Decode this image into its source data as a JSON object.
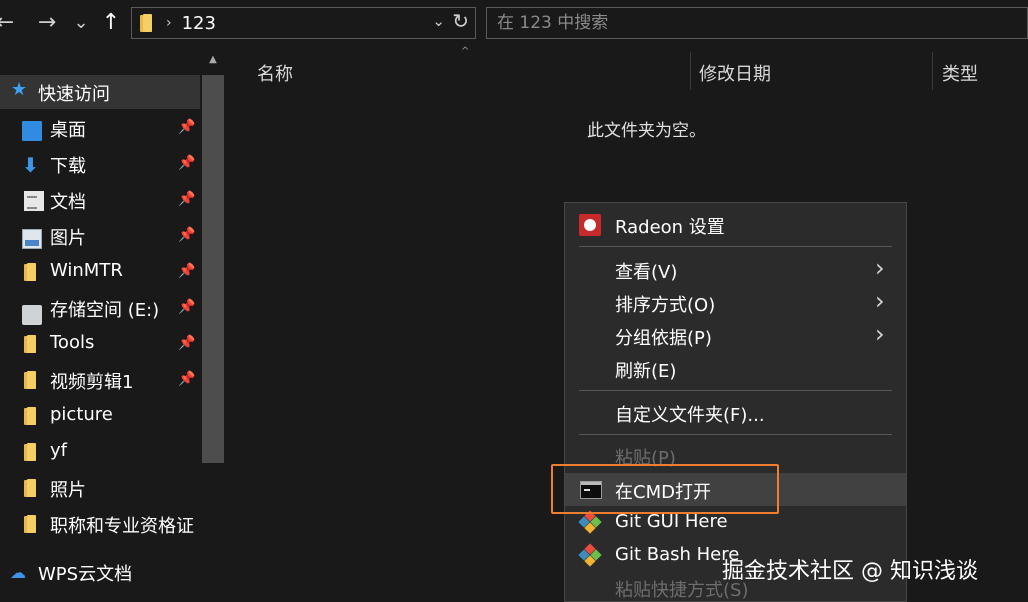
{
  "nav": {
    "back_glyph": "←",
    "forward_glyph": "→",
    "recent_glyph": "⌄",
    "up_glyph": "↑"
  },
  "address": {
    "separator": "›",
    "path": "123",
    "dropdown_glyph": "⌄",
    "refresh_glyph": "↻"
  },
  "search": {
    "placeholder": "在 123 中搜索"
  },
  "sidebar": {
    "quick_access": "快速访问",
    "items": [
      {
        "label": "桌面",
        "icon": "desktop-icon",
        "pinned": true
      },
      {
        "label": "下载",
        "icon": "download-icon",
        "pinned": true
      },
      {
        "label": "文档",
        "icon": "document-icon",
        "pinned": true
      },
      {
        "label": "图片",
        "icon": "pictures-icon",
        "pinned": true
      },
      {
        "label": "WinMTR",
        "icon": "folder-icon",
        "pinned": true
      },
      {
        "label": "存储空间 (E:)",
        "icon": "drive-icon",
        "pinned": true
      },
      {
        "label": "Tools",
        "icon": "folder-icon",
        "pinned": true
      },
      {
        "label": "视频剪辑1",
        "icon": "folder-icon",
        "pinned": true
      },
      {
        "label": "picture",
        "icon": "folder-icon",
        "pinned": false
      },
      {
        "label": "yf",
        "icon": "folder-icon",
        "pinned": false
      },
      {
        "label": "照片",
        "icon": "folder-icon",
        "pinned": false
      },
      {
        "label": "职称和专业资格证",
        "icon": "folder-icon",
        "pinned": false
      }
    ],
    "wps": "WPS云文档",
    "pin_glyph": "📌"
  },
  "columns": {
    "name": "名称",
    "modified": "修改日期",
    "type": "类型",
    "sort_glyph": "^"
  },
  "main": {
    "empty_message": "此文件夹为空。"
  },
  "context_menu": {
    "radeon": "Radeon 设置",
    "view": "查看(V)",
    "sort": "排序方式(O)",
    "group": "分组依据(P)",
    "refresh": "刷新(E)",
    "customize": "自定义文件夹(F)...",
    "paste": "粘贴(P)",
    "open_cmd": "在CMD打开",
    "git_gui": "Git GUI Here",
    "git_bash": "Git Bash Here",
    "paste_shortcut": "粘贴快捷方式(S)",
    "submenu_glyph": "›"
  },
  "watermark": "掘金技术社区 @ 知识浅谈",
  "colors": {
    "background": "#191919",
    "menu_bg": "#2b2b2b",
    "highlight": "#ee7e2d",
    "accent_blue": "#3ea0f5"
  }
}
